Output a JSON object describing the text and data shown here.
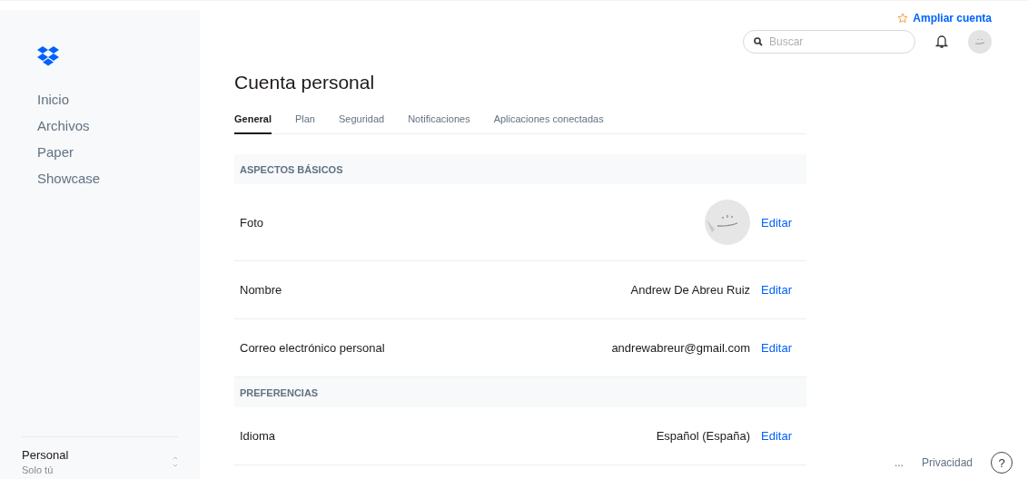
{
  "sidebar": {
    "items": [
      {
        "label": "Inicio",
        "selected": false
      },
      {
        "label": "Archivos",
        "selected": false
      },
      {
        "label": "Paper",
        "selected": false
      },
      {
        "label": "Showcase",
        "selected": false
      }
    ],
    "account": {
      "name": "Personal",
      "subtitle": "Solo tú"
    }
  },
  "upgrade": {
    "label": "Ampliar cuenta"
  },
  "search": {
    "placeholder": "Buscar"
  },
  "title": "Cuenta personal",
  "tabs": [
    {
      "label": "General",
      "selected": true
    },
    {
      "label": "Plan",
      "selected": false
    },
    {
      "label": "Seguridad",
      "selected": false
    },
    {
      "label": "Notificaciones",
      "selected": false
    },
    {
      "label": "Aplicaciones conectadas",
      "selected": false
    }
  ],
  "sections": [
    {
      "heading": "ASPECTOS BÁSICOS",
      "rows": [
        {
          "kind": "photo",
          "label": "Foto",
          "action": "Editar"
        },
        {
          "kind": "text",
          "label": "Nombre",
          "value": "Andrew De Abreu Ruiz",
          "action": "Editar"
        },
        {
          "kind": "text",
          "label": "Correo electrónico personal",
          "value": "andrewabreur@gmail.com",
          "action": "Editar"
        }
      ]
    },
    {
      "heading": "PREFERENCIAS",
      "rows": [
        {
          "kind": "text",
          "label": "Idioma",
          "value": "Español (España)",
          "action": "Editar"
        }
      ]
    }
  ],
  "footer": {
    "more": "...",
    "privacy": "Privacidad",
    "help": "?"
  }
}
